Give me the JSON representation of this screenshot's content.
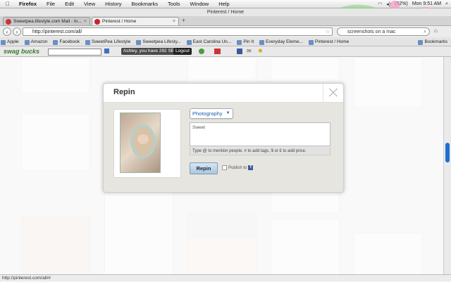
{
  "menubar": {
    "apple": "",
    "app": "Firefox",
    "items": [
      "File",
      "Edit",
      "View",
      "History",
      "Bookmarks",
      "Tools",
      "Window",
      "Help"
    ],
    "battery": "(92%)",
    "clock": "Mon 9:51 AM"
  },
  "window": {
    "title": "Pinterest / Home"
  },
  "tabs": [
    {
      "label": "Sweetpea.lifestyle.com Mail - In...",
      "favicon_color": "#c33"
    },
    {
      "label": "Pinterest / Home",
      "favicon_color": "#c8232c"
    }
  ],
  "nav": {
    "url": "http://pinterest.com/all/",
    "search_value": "screenshots on a mac"
  },
  "bookmarks": [
    "Apple",
    "Amazon",
    "Facebook",
    "SweetPea Lifestyle",
    "Sweetpea Lifesty...",
    "East Carolina Un...",
    "Pin It",
    "Everyday Eleme...",
    "Pinterest / Home",
    "Bookmarks"
  ],
  "swagbar": {
    "logo": "swag bucks",
    "user": "Ashley, you have 292 SB",
    "logout": "Logout"
  },
  "modal": {
    "title": "Repin",
    "board": "Photography",
    "description": "Sweet",
    "hint": "Type @ to mention people, # to add tags, $ or £ to add price.",
    "repin_button": "Repin",
    "publish_label": "Publish to",
    "facebook_glyph": "f"
  },
  "status": {
    "url": "http://pinterest.com/all/#"
  },
  "colors": {
    "accent": "#1b5fb0",
    "scroll": "#1f6fd0",
    "brand_pinterest": "#c8232c"
  }
}
